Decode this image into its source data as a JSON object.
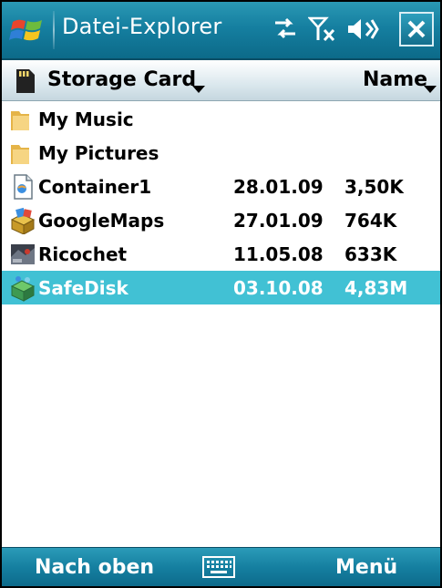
{
  "titlebar": {
    "title": "Datei-Explorer",
    "icons": [
      "windows-start-icon",
      "connectivity-icon",
      "signal-off-icon",
      "volume-icon",
      "close-icon"
    ]
  },
  "header": {
    "folder": "Storage Card",
    "sort": "Name"
  },
  "files": [
    {
      "name": "My Music",
      "date": "",
      "size": "",
      "icon": "folder-icon",
      "selected": false
    },
    {
      "name": "My Pictures",
      "date": "",
      "size": "",
      "icon": "folder-icon",
      "selected": false
    },
    {
      "name": "Container1",
      "date": "28.01.09",
      "size": "3,50K",
      "icon": "document-icon",
      "selected": false
    },
    {
      "name": "GoogleMaps",
      "date": "27.01.09",
      "size": "764K",
      "icon": "installer-icon",
      "selected": false
    },
    {
      "name": "Ricochet",
      "date": "11.05.08",
      "size": "633K",
      "icon": "game-icon",
      "selected": false
    },
    {
      "name": "SafeDisk",
      "date": "03.10.08",
      "size": "4,83M",
      "icon": "safedisk-icon",
      "selected": true
    }
  ],
  "softkeys": {
    "left": "Nach oben",
    "right": "Menü"
  },
  "colors": {
    "titlebar": "#157fa0",
    "selection": "#41c1d4",
    "softbar": "#157fa0"
  }
}
